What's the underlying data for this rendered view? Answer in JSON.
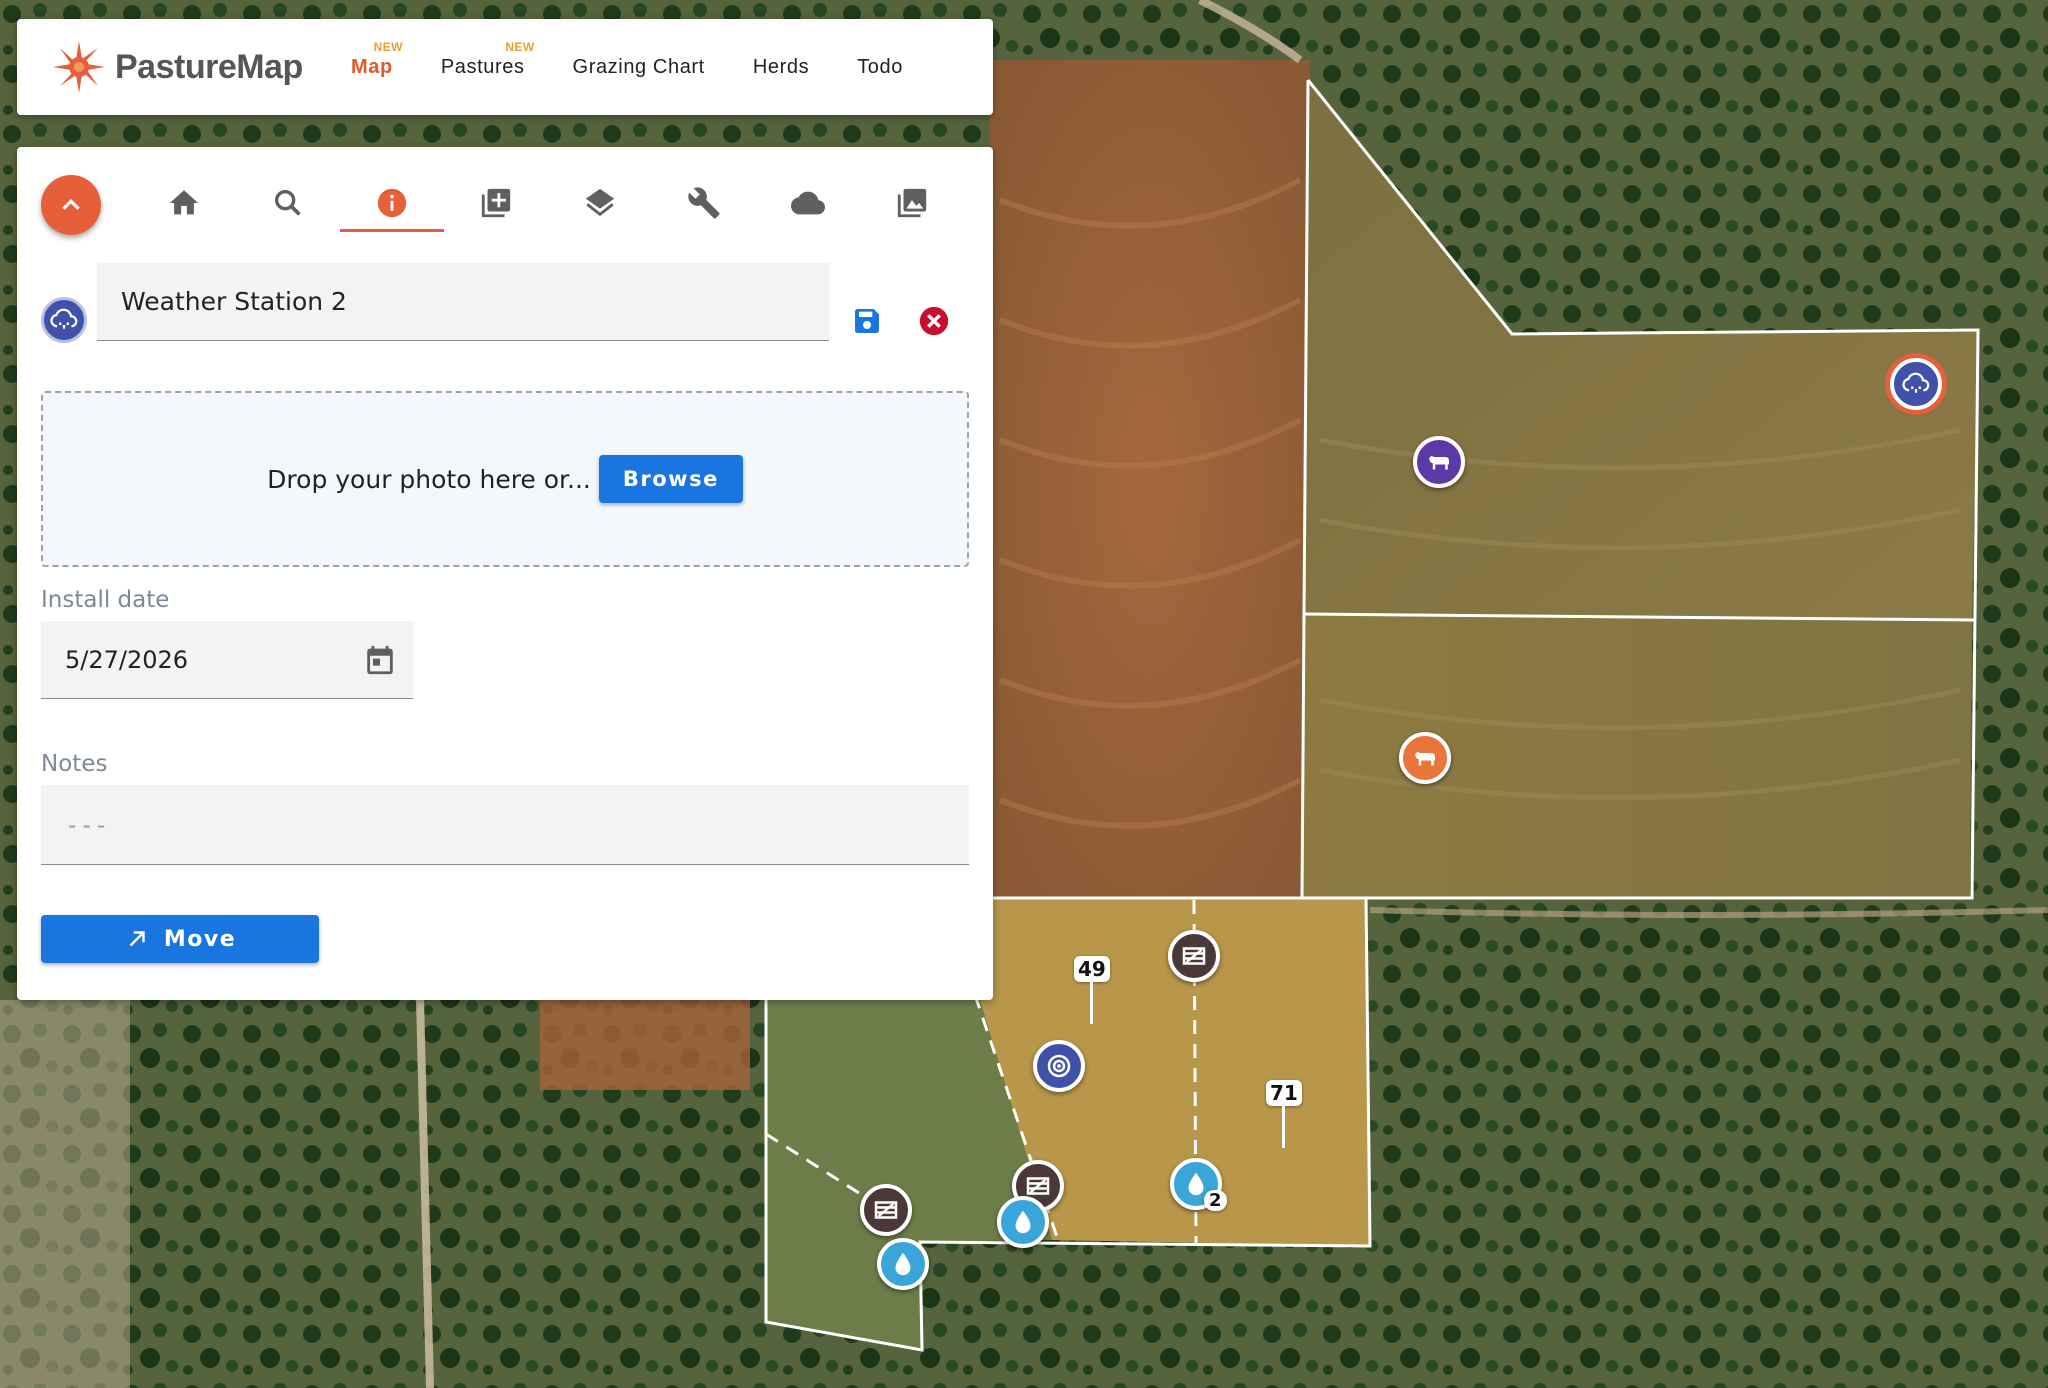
{
  "app": {
    "logo_text": "PastureMap"
  },
  "nav": {
    "items": [
      {
        "label": "Map",
        "badge": "NEW",
        "active": true
      },
      {
        "label": "Pastures",
        "badge": "NEW",
        "active": false
      },
      {
        "label": "Grazing Chart",
        "badge": "",
        "active": false
      },
      {
        "label": "Herds",
        "badge": "",
        "active": false
      },
      {
        "label": "Todo",
        "badge": "",
        "active": false
      }
    ]
  },
  "toolbar": {
    "tabs": [
      {
        "icon": "home-icon"
      },
      {
        "icon": "search-icon"
      },
      {
        "icon": "info-icon",
        "active": true
      },
      {
        "icon": "add-feature-icon"
      },
      {
        "icon": "layers-icon"
      },
      {
        "icon": "wrench-icon"
      },
      {
        "icon": "cloud-icon"
      },
      {
        "icon": "photo-library-icon"
      }
    ]
  },
  "feature": {
    "icon": "weather-station-icon",
    "name_value": "Weather Station 2"
  },
  "photo": {
    "drop_text": "Drop your photo here or...",
    "browse_label": "Browse"
  },
  "install_date": {
    "label": "Install date",
    "value": "5/27/2026"
  },
  "notes": {
    "label": "Notes",
    "placeholder": "---"
  },
  "actions": {
    "move_label": "Move"
  },
  "map": {
    "labels": [
      {
        "text": "49"
      },
      {
        "text": "71"
      }
    ],
    "water_count_badge": "2"
  },
  "colors": {
    "accent": "#e5603a",
    "primary_blue": "#1976e0",
    "herd_purple": "#5b3aa8",
    "herd_orange": "#e8763a",
    "weather_station": "#3f51a8",
    "water_blue": "#3aa5d9",
    "gate_brown": "#4a3838",
    "delete_red": "#c8102e"
  }
}
